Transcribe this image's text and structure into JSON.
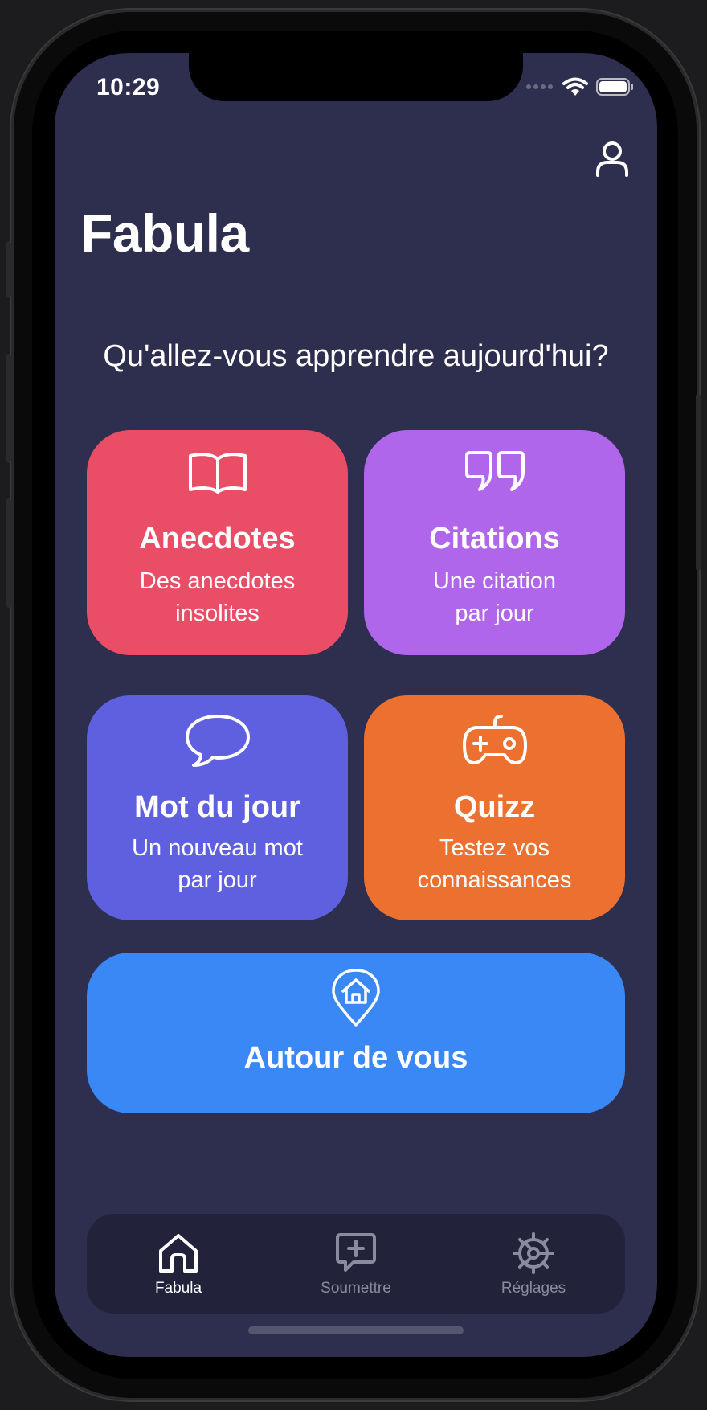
{
  "status_bar": {
    "time": "10:29"
  },
  "app_title": "Fabula",
  "prompt": "Qu'allez-vous apprendre aujourd'hui?",
  "cards": [
    {
      "title": "Anecdotes",
      "subtitle_line1": "Des anecdotes",
      "subtitle_line2": "insolites",
      "icon": "book-open-icon",
      "color": "#ea4e67"
    },
    {
      "title": "Citations",
      "subtitle_line1": "Une citation",
      "subtitle_line2": "par jour",
      "icon": "quote-icon",
      "color": "#b066ea"
    },
    {
      "title": "Mot du jour",
      "subtitle_line1": "Un nouveau mot",
      "subtitle_line2": "par jour",
      "icon": "speech-bubble-icon",
      "color": "#5e60e0"
    },
    {
      "title": "Quizz",
      "subtitle_line1": "Testez vos",
      "subtitle_line2": "connaissances",
      "icon": "gamepad-icon",
      "color": "#ec7030"
    },
    {
      "title": "Autour de vous",
      "icon": "location-home-icon",
      "color": "#3a87f6"
    }
  ],
  "tabs": [
    {
      "label": "Fabula",
      "icon": "home-icon",
      "active": true
    },
    {
      "label": "Soumettre",
      "icon": "add-message-icon",
      "active": false
    },
    {
      "label": "Réglages",
      "icon": "gear-icon",
      "active": false
    }
  ],
  "colors": {
    "background": "#2e2e4f",
    "tabbar": "#22223a",
    "active_tab": "#ffffff",
    "inactive_tab": "#8a8aa0"
  }
}
